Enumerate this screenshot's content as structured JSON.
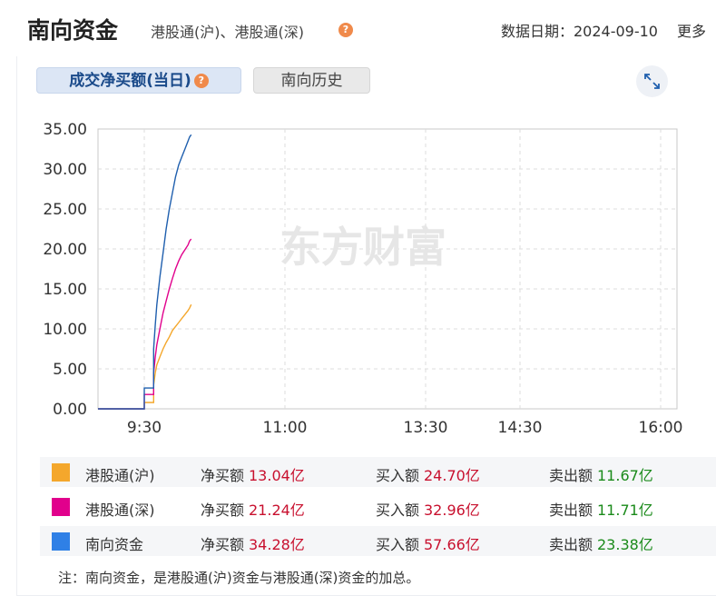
{
  "header": {
    "title": "南向资金",
    "subtitle": "港股通(沪)、港股通(深)",
    "date_label": "数据日期：2024-09-10",
    "more_label": "更多",
    "help_glyph": "?"
  },
  "tabs": [
    {
      "label": "成交净买额(当日)",
      "active": true
    },
    {
      "label": "南向历史",
      "active": false
    }
  ],
  "watermark": "东方财富",
  "chart_data": {
    "type": "line",
    "y_ticks": [
      "35.00",
      "30.00",
      "25.00",
      "20.00",
      "15.00",
      "10.00",
      "5.00",
      "0.00"
    ],
    "x_ticks": [
      "9:30",
      "11:00",
      "13:30",
      "14:30",
      "16:00"
    ],
    "ylim": [
      0,
      35
    ],
    "grid": true,
    "legend_position": "bottom",
    "series": [
      {
        "name": "港股通(沪)",
        "color": "#f4a72c",
        "points": [
          [
            -11,
            0
          ],
          [
            -5,
            0
          ],
          [
            0,
            0
          ],
          [
            0,
            0.8
          ],
          [
            6,
            0.8
          ],
          [
            6,
            3
          ],
          [
            7,
            4.5
          ],
          [
            8,
            5.5
          ],
          [
            10,
            6.5
          ],
          [
            12,
            7.5
          ],
          [
            14,
            8.3
          ],
          [
            16,
            9
          ],
          [
            18,
            9.8
          ],
          [
            20,
            10.3
          ],
          [
            22,
            10.8
          ],
          [
            24,
            11.3
          ],
          [
            26,
            11.8
          ],
          [
            28,
            12.3
          ],
          [
            29,
            12.6
          ],
          [
            30,
            13.04
          ]
        ]
      },
      {
        "name": "港股通(深)",
        "color": "#e1008c",
        "points": [
          [
            -11,
            0
          ],
          [
            -5,
            0
          ],
          [
            0,
            0
          ],
          [
            0,
            1.8
          ],
          [
            6,
            1.8
          ],
          [
            6,
            4.5
          ],
          [
            7,
            6.5
          ],
          [
            8,
            8
          ],
          [
            10,
            10
          ],
          [
            12,
            12
          ],
          [
            14,
            13.5
          ],
          [
            16,
            15
          ],
          [
            18,
            16.3
          ],
          [
            20,
            17.5
          ],
          [
            22,
            18.5
          ],
          [
            24,
            19.3
          ],
          [
            26,
            19.9
          ],
          [
            28,
            20.5
          ],
          [
            29,
            21
          ],
          [
            30,
            21.24
          ]
        ]
      },
      {
        "name": "南向资金",
        "color": "#1f5fae",
        "points": [
          [
            -11,
            0
          ],
          [
            -5,
            0
          ],
          [
            0,
            0
          ],
          [
            0,
            2.6
          ],
          [
            6,
            2.6
          ],
          [
            6,
            7.5
          ],
          [
            7,
            10.5
          ],
          [
            8,
            13
          ],
          [
            10,
            16.5
          ],
          [
            12,
            19.5
          ],
          [
            14,
            22.5
          ],
          [
            16,
            25
          ],
          [
            18,
            27
          ],
          [
            20,
            29
          ],
          [
            22,
            30.5
          ],
          [
            24,
            31.5
          ],
          [
            26,
            32.5
          ],
          [
            28,
            33.5
          ],
          [
            29,
            34
          ],
          [
            30,
            34.28
          ]
        ]
      }
    ]
  },
  "legend": [
    {
      "name": "港股通(沪)",
      "color": "#f4a72c",
      "net_label": "净买额",
      "net_value": "13.04亿",
      "buy_label": "买入额",
      "buy_value": "24.70亿",
      "sell_label": "卖出额",
      "sell_value": "11.67亿"
    },
    {
      "name": "港股通(深)",
      "color": "#e1008c",
      "net_label": "净买额",
      "net_value": "21.24亿",
      "buy_label": "买入额",
      "buy_value": "32.96亿",
      "sell_label": "卖出额",
      "sell_value": "11.71亿"
    },
    {
      "name": "南向资金",
      "color": "#2f80e6",
      "net_label": "净买额",
      "net_value": "34.28亿",
      "buy_label": "买入额",
      "buy_value": "57.66亿",
      "sell_label": "卖出额",
      "sell_value": "23.38亿"
    }
  ],
  "note": "注：南向资金，是港股通(沪)资金与港股通(深)资金的加总。"
}
